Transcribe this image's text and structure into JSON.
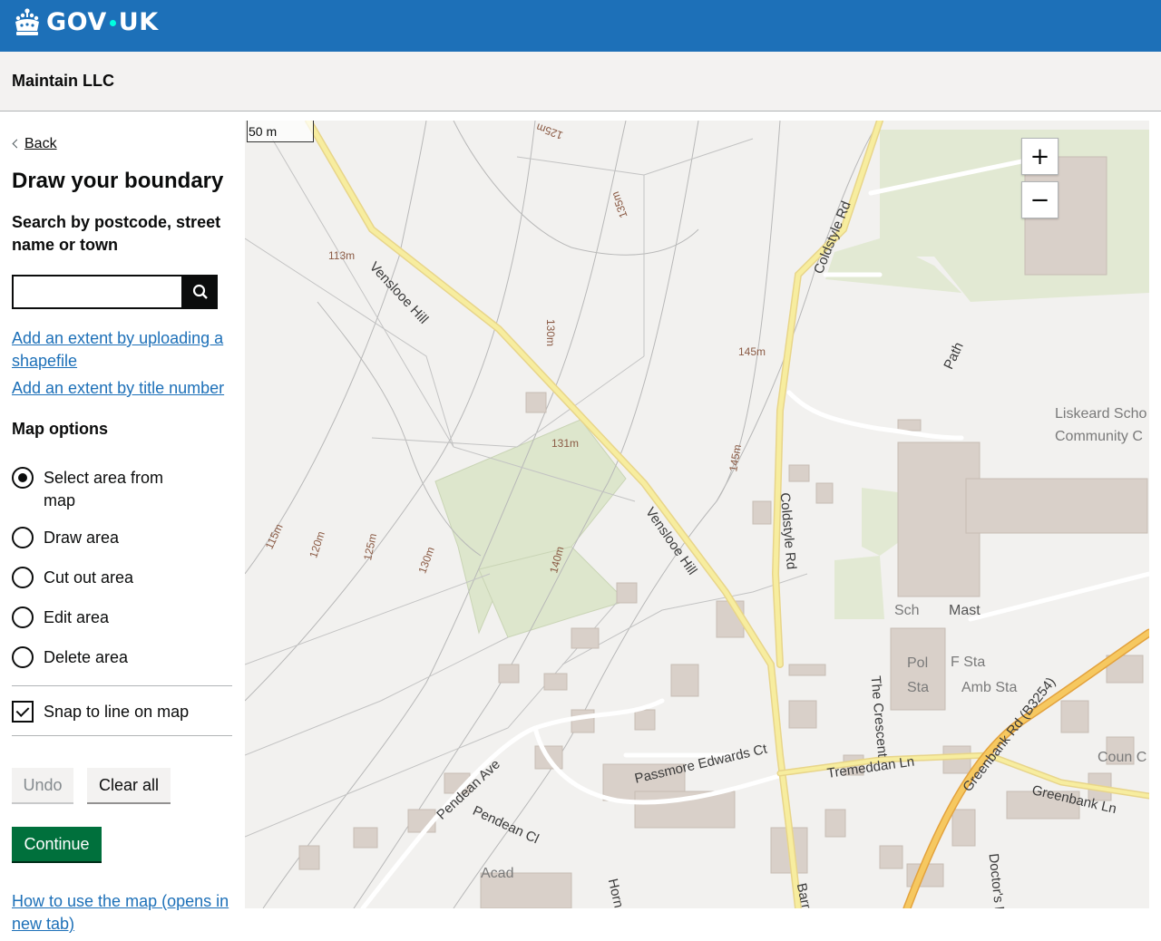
{
  "header": {
    "brand": "GOV.UK",
    "brand_left": "GOV",
    "brand_right": "UK"
  },
  "service": {
    "name": "Maintain LLC"
  },
  "sidebar": {
    "back_label": "Back",
    "title": "Draw your boundary",
    "search_label": "Search by postcode, street name or town",
    "search_value": "",
    "search_placeholder": "",
    "upload_link": "Add an extent by uploading a shapefile",
    "title_number_link": "Add an extent by title number",
    "map_options_label": "Map options",
    "options": [
      {
        "label": "Select area from map",
        "checked": true
      },
      {
        "label": "Draw area",
        "checked": false
      },
      {
        "label": "Cut out area",
        "checked": false
      },
      {
        "label": "Edit area",
        "checked": false
      },
      {
        "label": "Delete area",
        "checked": false
      }
    ],
    "snap_label": "Snap to line on map",
    "snap_checked": true,
    "undo_label": "Undo",
    "clear_label": "Clear all",
    "continue_label": "Continue",
    "howto_link": "How to use the map (opens in new tab)"
  },
  "map": {
    "scale_label": "50 m",
    "zoom_in": "+",
    "zoom_out": "−",
    "roads": {
      "venslooe_1": "Venslooe Hill",
      "venslooe_2": "Venslooe Hill",
      "coldstyle_1": "Coldstyle Rd",
      "coldstyle_2": "Coldstyle Rd",
      "path": "Path",
      "crescent": "The Crescent",
      "tremeddan": "Tremeddan Ln",
      "greenbank_rd": "Greenbank Rd (B3254)",
      "greenbank_ln": "Greenbank Ln",
      "passmore": "Passmore Edwards Ct",
      "pendean_ave": "Pendean Ave",
      "pendean_cl": "Pendean Cl",
      "horn": "Horn Ln",
      "barras": "Barras",
      "doctors": "Doctor's Ln"
    },
    "contours": {
      "c125_top": "125m",
      "c135": "135m",
      "c113": "113m",
      "c130_mid": "130m",
      "c145_a": "145m",
      "c131": "131m",
      "c145_b": "145m",
      "c115": "115m",
      "c120": "120m",
      "c125_low": "125m",
      "c130_low": "130m",
      "c140": "140m"
    },
    "places": {
      "school_1": "Liskeard Scho",
      "school_2": "Community C",
      "sch": "Sch",
      "mast": "Mast",
      "pol": "Pol",
      "sta_1": "Sta",
      "f_sta": "F Sta",
      "amb_sta": "Amb Sta",
      "coun": "Coun C",
      "acad": "Acad"
    }
  }
}
